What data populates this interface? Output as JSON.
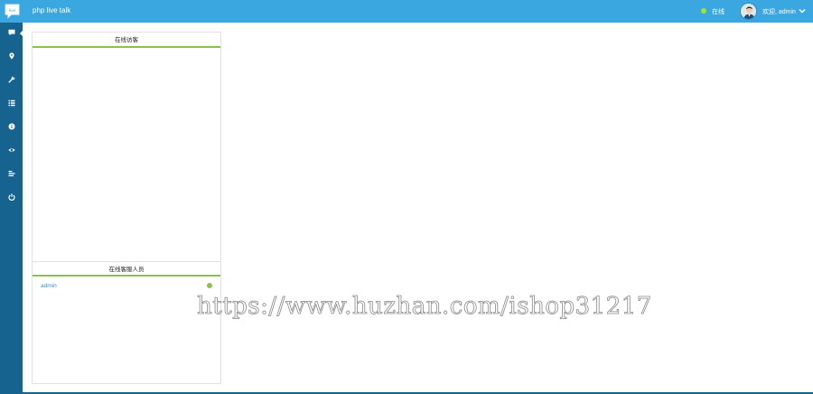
{
  "header": {
    "app_title": "php live talk",
    "status_label": "在线",
    "welcome_label": "欢迎, admin"
  },
  "sidebar": {
    "items": [
      {
        "icon": "chat-icon",
        "active": true
      },
      {
        "icon": "location-pin-icon"
      },
      {
        "icon": "wrench-icon"
      },
      {
        "icon": "list-icon"
      },
      {
        "icon": "info-icon"
      },
      {
        "icon": "eye-icon"
      },
      {
        "icon": "bars-icon"
      },
      {
        "icon": "power-icon"
      }
    ]
  },
  "panel": {
    "visitors_title": "在线访客",
    "staff_title": "在线客服人员",
    "staff": [
      {
        "name": "admin",
        "status_color": "#8bc34a"
      }
    ]
  },
  "watermark": "https://www.huzhan.com/ishop31217",
  "colors": {
    "topbar": "#3aa7e0",
    "sidebar": "#16638f",
    "accent_green": "#8bc34a"
  }
}
